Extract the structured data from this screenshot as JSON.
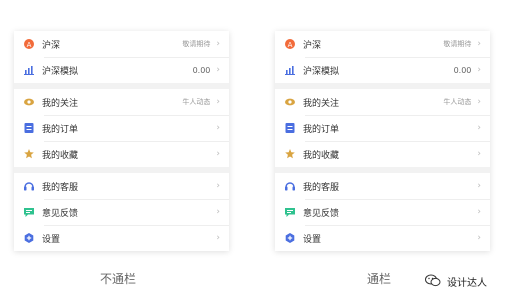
{
  "rows": {
    "hushen": {
      "label": "沪深",
      "value": "敬请期待",
      "icon": "hushen-a-icon"
    },
    "hushen_sim": {
      "label": "沪深模拟",
      "value": "0.00",
      "icon": "bar-chart-icon"
    },
    "follow": {
      "label": "我的关注",
      "value": "牛人动态",
      "icon": "eye-icon"
    },
    "orders": {
      "label": "我的订单",
      "icon": "order-list-icon"
    },
    "favorites": {
      "label": "我的收藏",
      "icon": "star-box-icon"
    },
    "service": {
      "label": "我的客服",
      "icon": "headset-icon"
    },
    "feedback": {
      "label": "意见反馈",
      "icon": "feedback-icon"
    },
    "settings": {
      "label": "设置",
      "icon": "gear-hex-icon"
    }
  },
  "chevron": "›",
  "captions": {
    "left": "不通栏",
    "right": "通栏"
  },
  "watermark": {
    "text": "设计达人"
  },
  "colors": {
    "orange": "#f26b3a",
    "blue": "#4a6ee0",
    "gold": "#d9a441",
    "green": "#2fc28f",
    "section_gap": "#f2f2f2"
  }
}
